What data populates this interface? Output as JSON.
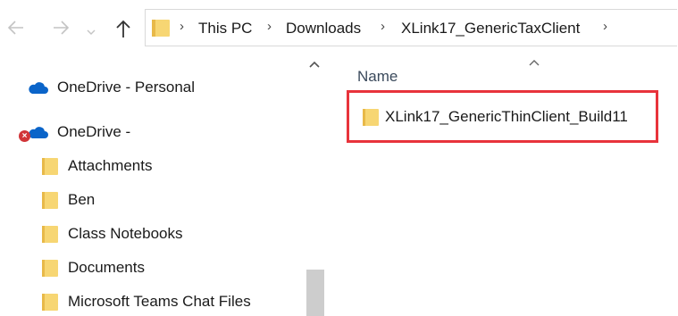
{
  "address_bar": {
    "crumbs": [
      "This PC",
      "Downloads",
      "XLink17_GenericTaxClient"
    ]
  },
  "navigation_pane": {
    "items": [
      {
        "label": "OneDrive - Personal",
        "icon": "onedrive-cloud-icon"
      },
      {
        "label": "OneDrive -",
        "icon": "onedrive-cloud-icon",
        "badge": "error"
      },
      {
        "label": "Attachments",
        "icon": "folder-icon"
      },
      {
        "label": "Ben",
        "icon": "folder-icon"
      },
      {
        "label": "Class Notebooks",
        "icon": "folder-icon"
      },
      {
        "label": "Documents",
        "icon": "folder-icon"
      },
      {
        "label": "Microsoft Teams Chat Files",
        "icon": "folder-icon"
      }
    ]
  },
  "content": {
    "column_header": "Name",
    "files": [
      {
        "name": "XLink17_GenericThinClient_Build11",
        "type": "folder",
        "highlighted": true
      }
    ]
  },
  "colors": {
    "highlight_border": "#e8333b",
    "folder": "#f7d673",
    "onedrive": "#0a64c9",
    "error_badge": "#d13438"
  }
}
